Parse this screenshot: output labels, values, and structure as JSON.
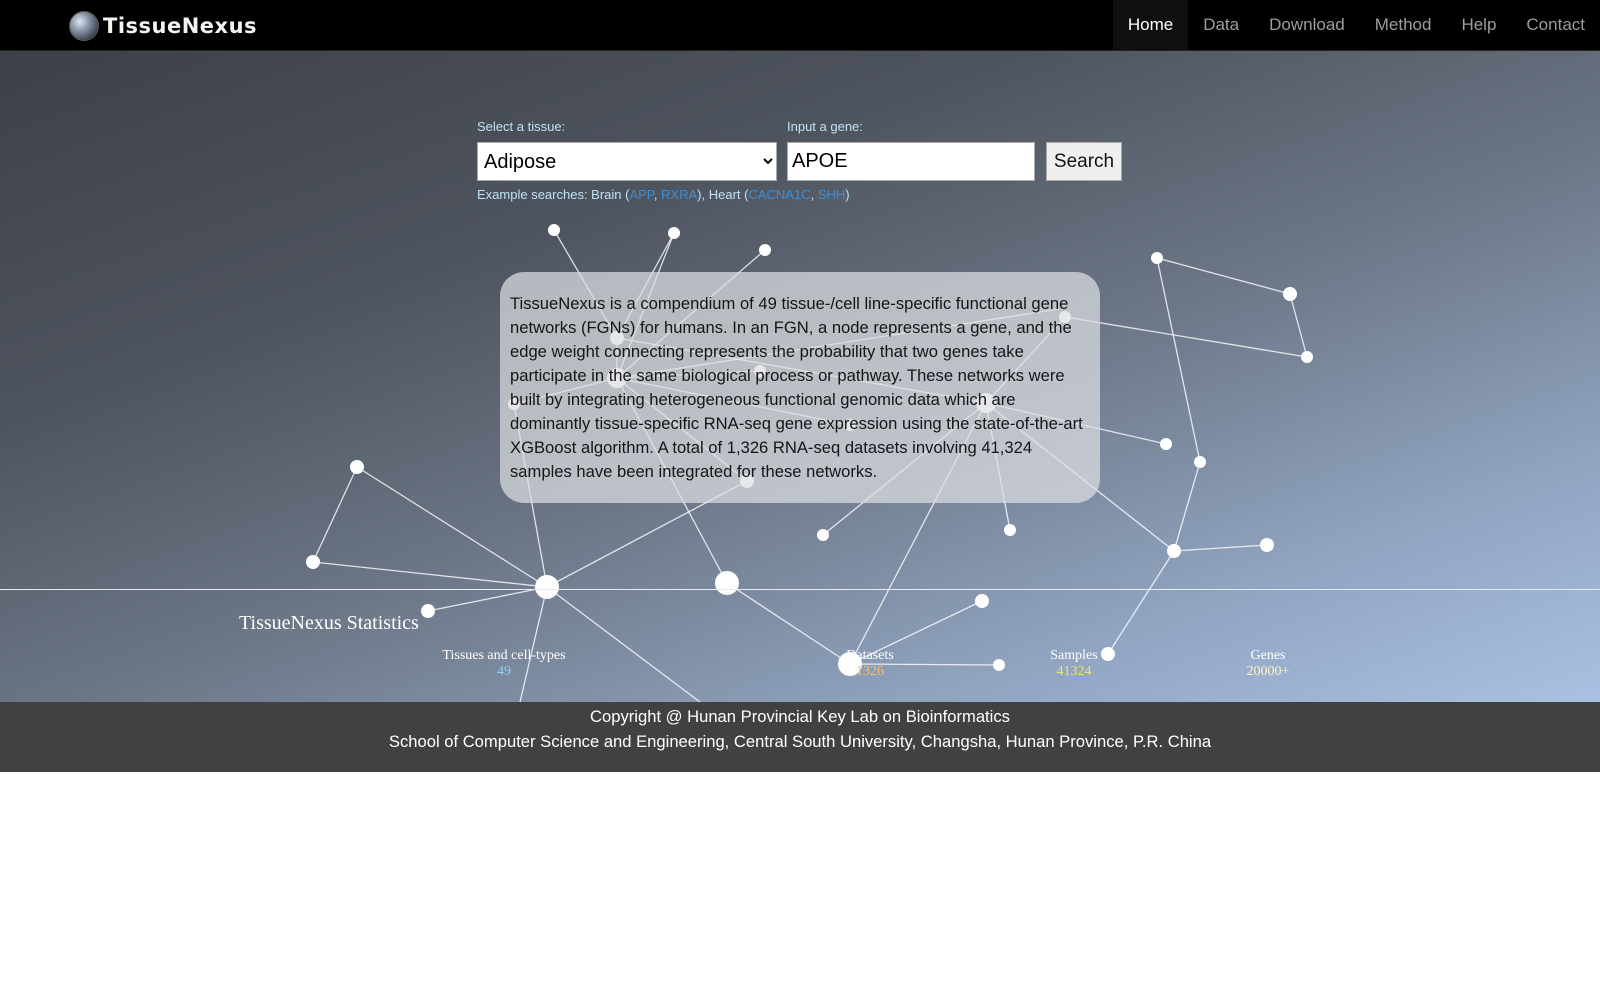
{
  "brand": {
    "name": "TissueNexus",
    "logo_icon": "globe-icon"
  },
  "nav": {
    "items": [
      {
        "label": "Home",
        "active": true
      },
      {
        "label": "Data",
        "active": false
      },
      {
        "label": "Download",
        "active": false
      },
      {
        "label": "Method",
        "active": false
      },
      {
        "label": "Help",
        "active": false
      },
      {
        "label": "Contact",
        "active": false
      }
    ]
  },
  "search": {
    "tissue_label": "Select a tissue:",
    "tissue_selected": "Adipose",
    "gene_label": "Input a gene:",
    "gene_value": "APOE",
    "button_label": "Search",
    "examples": {
      "prefix": "Example searches: ",
      "brain_label": "Brain (",
      "brain_genes": [
        "APP",
        "RXRA"
      ],
      "heart_label": "), Heart (",
      "heart_genes": [
        "CACNA1C",
        "SHH"
      ],
      "sep": ", ",
      "suffix": ")"
    }
  },
  "about": {
    "text": "TissueNexus is a compendium of 49 tissue-/cell line-specific functional gene networks (FGNs) for humans. In an FGN, a node represents a gene, and the edge weight connecting represents the probability that two genes take participate in the same biological process or pathway. These networks were built by integrating heterogeneous functional genomic data which are dominantly tissue-specific RNA-seq gene expression using the state-of-the-art XGBoost algorithm. A total of 1,326 RNA-seq datasets involving 41,324 samples have been integrated for these networks."
  },
  "statistics": {
    "title": "TissueNexus Statistics",
    "items": [
      {
        "name": "Tissues and cell-types",
        "value": "49"
      },
      {
        "name": "Datasets",
        "value": "1326"
      },
      {
        "name": "Samples",
        "value": "41324"
      },
      {
        "name": "Genes",
        "value": "20000+"
      }
    ]
  },
  "footer": {
    "line1": "Copyright @ Hunan Provincial Key Lab on Bioinformatics",
    "line2": "School of Computer Science and Engineering, Central South University, Changsha, Hunan Province, P.R. China"
  },
  "colors": {
    "nav_bg": "#000000",
    "footer_bg": "#414141",
    "link_blue": "#3c8fd6",
    "label_cyan": "#bfe3f5"
  }
}
